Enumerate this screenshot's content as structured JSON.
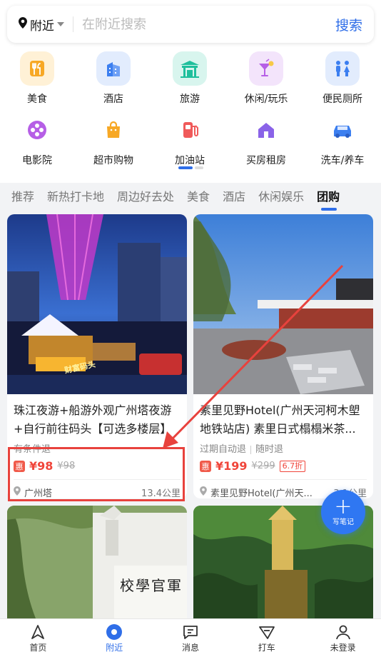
{
  "search": {
    "location_label": "附近",
    "placeholder": "在附近搜索",
    "button_label": "搜索"
  },
  "categories": [
    {
      "label": "美食",
      "icon": "food-icon",
      "color": "#f7a825"
    },
    {
      "label": "酒店",
      "icon": "hotel-icon",
      "color": "#3c7ff0"
    },
    {
      "label": "旅游",
      "icon": "travel-icon",
      "color": "#1fbf9c"
    },
    {
      "label": "休闲/玩乐",
      "icon": "cocktail-icon",
      "color": "#b65fe6"
    },
    {
      "label": "便民厕所",
      "icon": "toilet-icon",
      "color": "#3c7ff0"
    },
    {
      "label": "电影院",
      "icon": "film-icon",
      "color": "#b65fe6"
    },
    {
      "label": "超市购物",
      "icon": "shopping-bag-icon",
      "color": "#f7a825"
    },
    {
      "label": "加油站",
      "icon": "gas-station-icon",
      "color": "#f05a5a"
    },
    {
      "label": "买房租房",
      "icon": "house-icon",
      "color": "#8a63e8"
    },
    {
      "label": "洗车/养车",
      "icon": "car-icon",
      "color": "#3c7ff0"
    }
  ],
  "tabs": [
    {
      "label": "推荐",
      "active": false
    },
    {
      "label": "新热打卡地",
      "active": false
    },
    {
      "label": "周边好去处",
      "active": false
    },
    {
      "label": "美食",
      "active": false
    },
    {
      "label": "酒店",
      "active": false
    },
    {
      "label": "休闲娱乐",
      "active": false
    },
    {
      "label": "团购",
      "active": true
    }
  ],
  "cards": [
    {
      "title": "珠江夜游+船游外观广州塔夜游+自行前往码头【可选多楼层】",
      "sub": [
        "有条件退"
      ],
      "price": "¥98",
      "original_price": "¥98",
      "discount": "",
      "location": "广州塔",
      "distance": "13.4公里",
      "image_sign": "财富码头"
    },
    {
      "title": "素里见野Hotel(广州天河柯木塱地铁站店) 素里日式榻榻米茶...",
      "sub": [
        "过期自动退",
        "随时退"
      ],
      "price": "¥199",
      "original_price": "¥299",
      "discount": "6.7折",
      "location": "素里见野Hotel(广州天...",
      "distance": "3.1公里"
    }
  ],
  "badge_label": "惠",
  "lower_card_sign": "校學官軍",
  "fab_label": "写笔记",
  "bottom_nav": [
    {
      "label": "首页",
      "icon": "home-arrow-icon",
      "active": false
    },
    {
      "label": "附近",
      "icon": "nearby-location-icon",
      "active": true
    },
    {
      "label": "消息",
      "icon": "message-icon",
      "active": false
    },
    {
      "label": "打车",
      "icon": "taxi-icon",
      "active": false
    },
    {
      "label": "未登录",
      "icon": "user-icon",
      "active": false
    }
  ],
  "colors": {
    "accent": "#2f6ee8",
    "price": "#f0453a",
    "highlight": "#e8423d"
  }
}
